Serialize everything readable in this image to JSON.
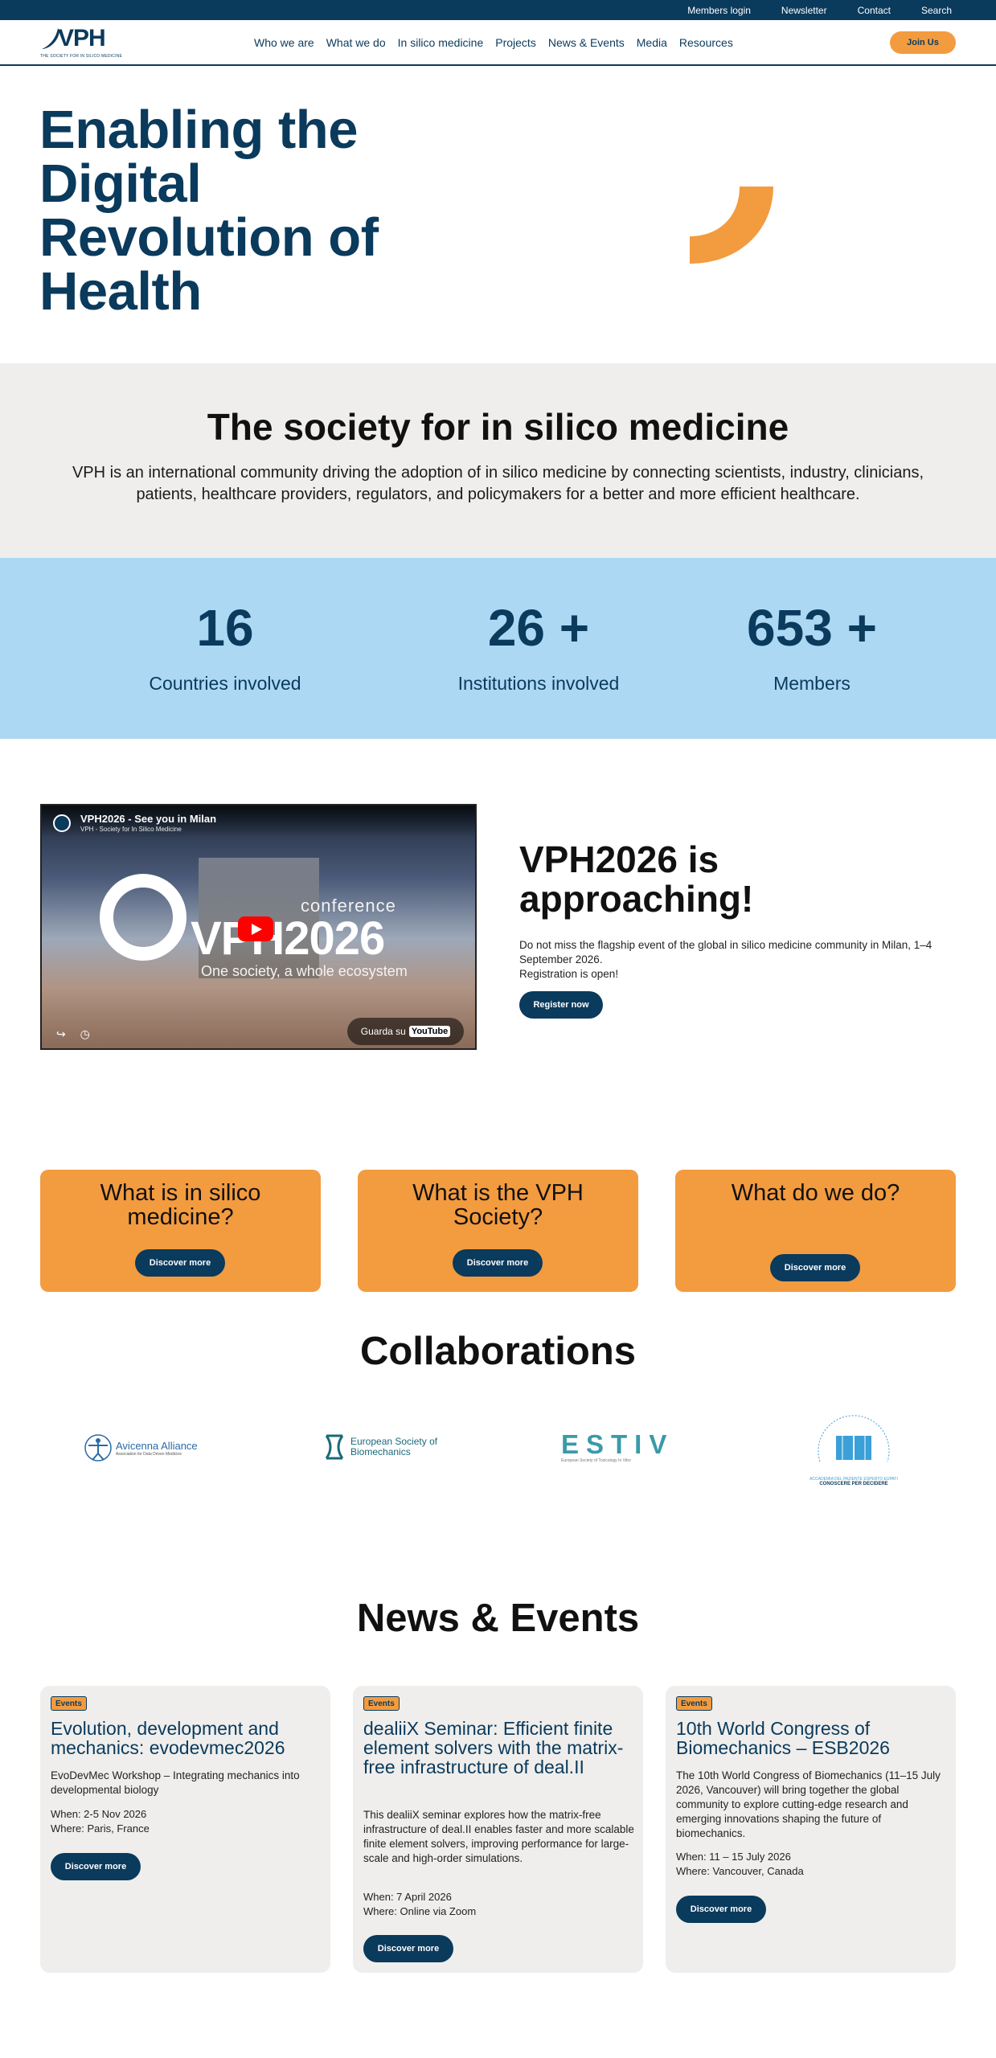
{
  "topbar": {
    "links": [
      "Members login",
      "Newsletter",
      "Contact",
      "Search"
    ]
  },
  "nav": {
    "logo_text": "VPH",
    "logo_tagline": "THE SOCIETY FOR IN SILICO MEDICINE",
    "items": [
      "Who we are",
      "What we do",
      "In silico medicine",
      "Projects",
      "News & Events",
      "Media",
      "Resources"
    ],
    "join_label": "Join Us"
  },
  "hero": {
    "title": "Enabling the Digital Revolution of Health"
  },
  "society": {
    "title": "The society for in silico medicine",
    "text": "VPH is an international community driving the adoption of in silico medicine by connecting scientists, industry, clinicians, patients, healthcare providers, regulators, and policymakers for a better and more efficient healthcare."
  },
  "stats": [
    {
      "value": "16",
      "label": "Countries involved"
    },
    {
      "value": "26 +",
      "label": "Institutions involved"
    },
    {
      "value": "653 +",
      "label": "Members"
    }
  ],
  "video": {
    "title": "VPH2026 - See you in Milan",
    "channel": "VPH - Society for In Silico Medicine",
    "overlay_small": "conference",
    "overlay_big": "VPH2026",
    "overlay_sub": "One society, a whole ecosystem",
    "watch_on": "Guarda su",
    "youtube": "YouTube"
  },
  "event": {
    "title": "VPH2026 is approaching!",
    "line1": "Do not miss the flagship event of the global in silico medicine community in Milan, 1–4 September 2026.",
    "line2": "Registration is open!",
    "button": "Register now"
  },
  "cards": [
    {
      "title": "What is in silico medicine?",
      "button": "Discover more"
    },
    {
      "title": "What is the VPH Society?",
      "button": "Discover more"
    },
    {
      "title": "What do we do?",
      "button": "Discover more"
    }
  ],
  "collaborations": {
    "title": "Collaborations",
    "logos": [
      {
        "name": "Avicenna Alliance",
        "sub": "Association for Data Driven Medicine",
        "icon": "vitruvian-icon"
      },
      {
        "name": "European Society of Biomechanics",
        "icon": "esb-icon"
      },
      {
        "name": "ESTIV",
        "sub": "European Society of Toxicology In Vitro",
        "icon": "estiv-icon"
      },
      {
        "name": "ACCADEMIA DEL PAZIENTE ESPERTO EUPATI",
        "sub": "CONOSCERE PER DECIDERE",
        "icon": "book-icon"
      }
    ]
  },
  "news": {
    "title": "News & Events",
    "items": [
      {
        "badge": "Events",
        "title": "Evolution, development and mechanics: evodevmec2026",
        "desc": "EvoDevMec Workshop – Integrating mechanics into developmental biology",
        "when": "When: 2-5 Nov 2026",
        "where": "Where: Paris, France",
        "button": "Discover more"
      },
      {
        "badge": "Events",
        "title": "dealiiX Seminar: Efficient finite element solvers with the matrix-free infrastructure of deal.II",
        "desc": "This dealiiX seminar explores how the matrix-free infrastructure of deal.II enables faster and more scalable finite element solvers, improving performance for large-scale and high-order simulations.",
        "when": "When: 7 April 2026",
        "where": "Where: Online via Zoom",
        "button": "Discover more"
      },
      {
        "badge": "Events",
        "title": "10th World Congress of Biomechanics – ESB2026",
        "desc": "The 10th World Congress of Biomechanics (11–15 July 2026, Vancouver) will bring together the global community to explore cutting-edge research and emerging innovations shaping the future of biomechanics.",
        "when": "When: 11 – 15 July 2026",
        "where": "Where: Vancouver, Canada",
        "button": "Discover more"
      }
    ]
  },
  "colors": {
    "navy": "#0a3a5c",
    "orange": "#f39b3f",
    "light_blue": "#acd8f4",
    "grey": "#efeeec"
  }
}
